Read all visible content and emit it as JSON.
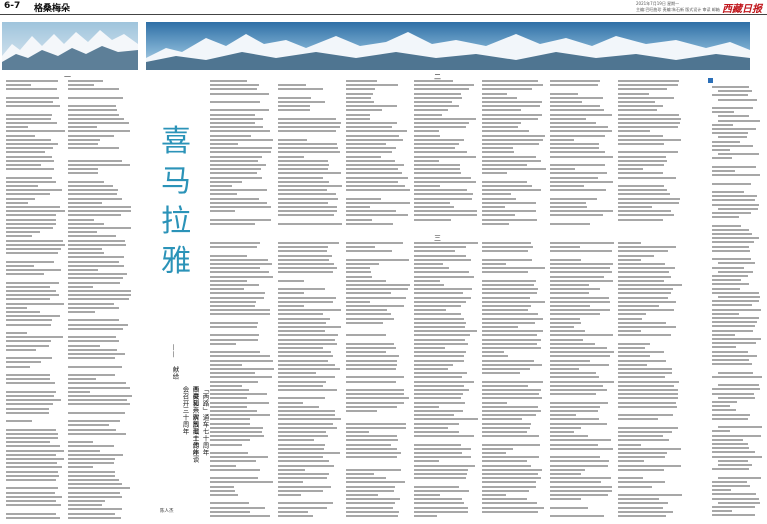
{
  "header": {
    "page_number": "6-7",
    "section": "格桑梅朵",
    "date_line": "2021年7月19日 星期一",
    "editor_line": "主编:巴旺曲珍  责编:朱石新  版式设计  审读  邮箱",
    "masthead": "西藏日报"
  },
  "column_numbers": [
    "一",
    "二",
    "三"
  ],
  "title_chars": [
    "喜",
    "马",
    "拉",
    "雅"
  ],
  "dedication": {
    "dash": "——",
    "prefix": "献给",
    "line1": "中央第六次西藏工作座谈会召开三十周年",
    "line2": "西藏和平解放七十周年",
    "line3": "「两路」通车七十周年"
  },
  "author": "陈人杰",
  "colors": {
    "title": "#2b93b8",
    "masthead": "#c0161c",
    "body_text": "#8a8a8a",
    "accent_badge": "#2b6fb8"
  }
}
